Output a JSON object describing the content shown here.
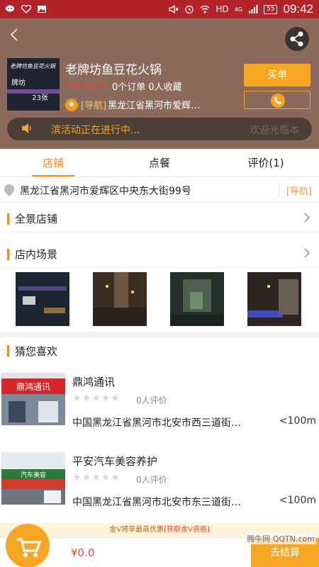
{
  "status_bar": {
    "network": "HD",
    "network_gen": "4G",
    "battery": "55",
    "time": "09:42"
  },
  "header": {
    "store_name": "老牌坊鱼豆花火锅",
    "thumb_sign": "老牌坊鱼豆花火锅",
    "thumb_logo": "牌坊",
    "thumb_count": "23张",
    "stars": "★★★★★",
    "stats": "0个订单 0人收藏",
    "nav_tag": "[导航]",
    "nav_address": "黑龙江省黑河市爱辉…",
    "buy_label": "买单",
    "notice_text": "滨活动正在进行中...",
    "welcome_text": "欢迎光临本"
  },
  "tabs": [
    {
      "label": "店铺"
    },
    {
      "label": "点餐"
    },
    {
      "label": "评价(1)"
    }
  ],
  "address": {
    "text": "黑龙江省黑河市爱辉区中央东大街99号",
    "nav_label": "[导航]"
  },
  "sections": {
    "panorama": "全景店铺",
    "interior": "店内场景",
    "recommend": "猜您喜欢"
  },
  "shops": [
    {
      "name": "鼎鸿通讯",
      "sign": "鼎鸿通讯",
      "stars": "★★★★★",
      "reviews": "0人评价",
      "address": "中国黑龙江省黑河市北安市西三道街…",
      "distance": "<100m"
    },
    {
      "name": "平安汽车美容养护",
      "sign": "汽车美容",
      "stars": "★★★★★",
      "reviews": "0人评价",
      "address": "中国黑龙江省黑河市北安市东三道街…",
      "distance": "<100m"
    }
  ],
  "promo": {
    "prefix": "金V将享最高优惠",
    "link": "[获取金V资格]"
  },
  "bottom": {
    "price": "¥0.0",
    "checkout": "去结算"
  },
  "watermark": "腾牛网 QQTN.com",
  "colors": {
    "accent": "#f08a1a",
    "header_bg": "#8c6a5b",
    "status_bg": "#b2242a"
  }
}
